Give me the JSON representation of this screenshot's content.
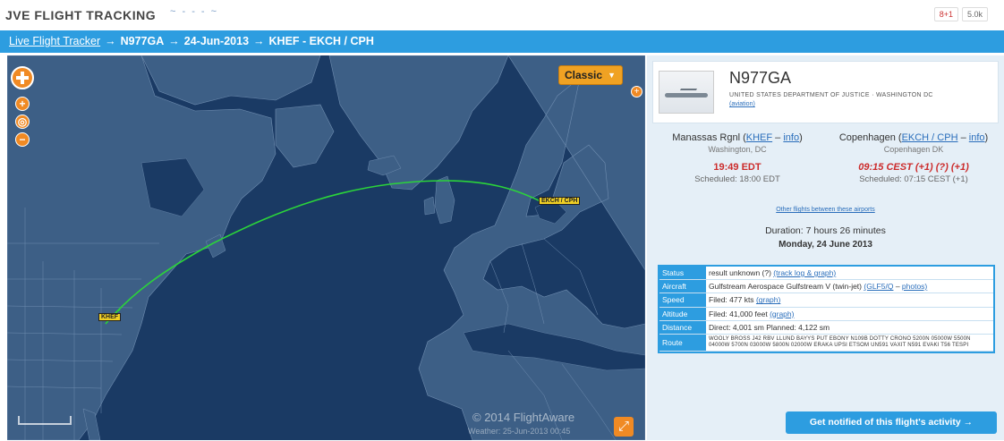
{
  "header": {
    "title": "JVE FLIGHT TRACKING",
    "sketch": "~ - - - ~",
    "buttons": [
      "8+1",
      "5.0k"
    ]
  },
  "breadcrumb": {
    "root": "Live Flight Tracker",
    "flight": "N977GA",
    "date": "24-Jun-2013",
    "route": "KHEF - EKCH / CPH",
    "separator": "→"
  },
  "map": {
    "view_mode": "Classic",
    "zoom_in": "+",
    "zoom_out": "−",
    "copyright": "© 2014 FlightAware",
    "weather": "Weather: 25-Jun-2013 00:45",
    "origin_label": "KHEF",
    "dest_label": "EKCH / CPH",
    "icons": [
      "pan-control-icon",
      "zoom-in-icon",
      "globe-icon",
      "zoom-out-icon",
      "expand-icon"
    ],
    "colors": {
      "ocean": "#1a3a64",
      "land": "#3d5f86",
      "track": "#2bd43a",
      "accent": "#f08a24"
    }
  },
  "aircraft": {
    "registration": "N977GA",
    "owner": "UNITED STATES DEPARTMENT OF JUSTICE · WASHINGTON DC",
    "owner_link": "(aviation)"
  },
  "origin": {
    "name": "Manassas Rgnl",
    "code": "KHEF",
    "info": "info",
    "city": "Washington, DC",
    "time": "19:49 EDT",
    "scheduled": "Scheduled: 18:00 EDT"
  },
  "destination": {
    "name": "Copenhagen",
    "code": "EKCH / CPH",
    "info": "info",
    "city": "Copenhagen DK",
    "time": "09:15 CEST (+1) (?) (+1)",
    "scheduled": "Scheduled: 07:15 CEST (+1)"
  },
  "between_link": "Other flights between these airports",
  "duration": "Duration: 7 hours 26 minutes",
  "date": "Monday, 24 June 2013",
  "details": {
    "status_label": "Status",
    "status_value": "result unknown (?)",
    "status_link": "(track log & graph)",
    "aircraft_label": "Aircraft",
    "aircraft_value": "Gulfstream Aerospace Gulfstream V (twin-jet)",
    "aircraft_code": "(GLF5/Q",
    "aircraft_photos": "photos)",
    "speed_label": "Speed",
    "speed_value": "Filed: 477 kts",
    "speed_link": "(graph)",
    "altitude_label": "Altitude",
    "altitude_value": "Filed: 41,000 feet",
    "altitude_link": "(graph)",
    "distance_label": "Distance",
    "distance_value": "Direct: 4,001 sm   Planned: 4,122 sm",
    "route_label": "Route",
    "route_value": "WOOLY BROSS J42 RBV LLUND BAYYS PUT EBONY N109B DOTTY CRONO 5200N 05000W 5500N 04000W 5700N 03000W 5800N 02000W ERAKA UPSI ETSOM UN591 VAXIT N591 EVAKI T56 TESPI"
  },
  "notify": "Get notified of this flight's activity →"
}
